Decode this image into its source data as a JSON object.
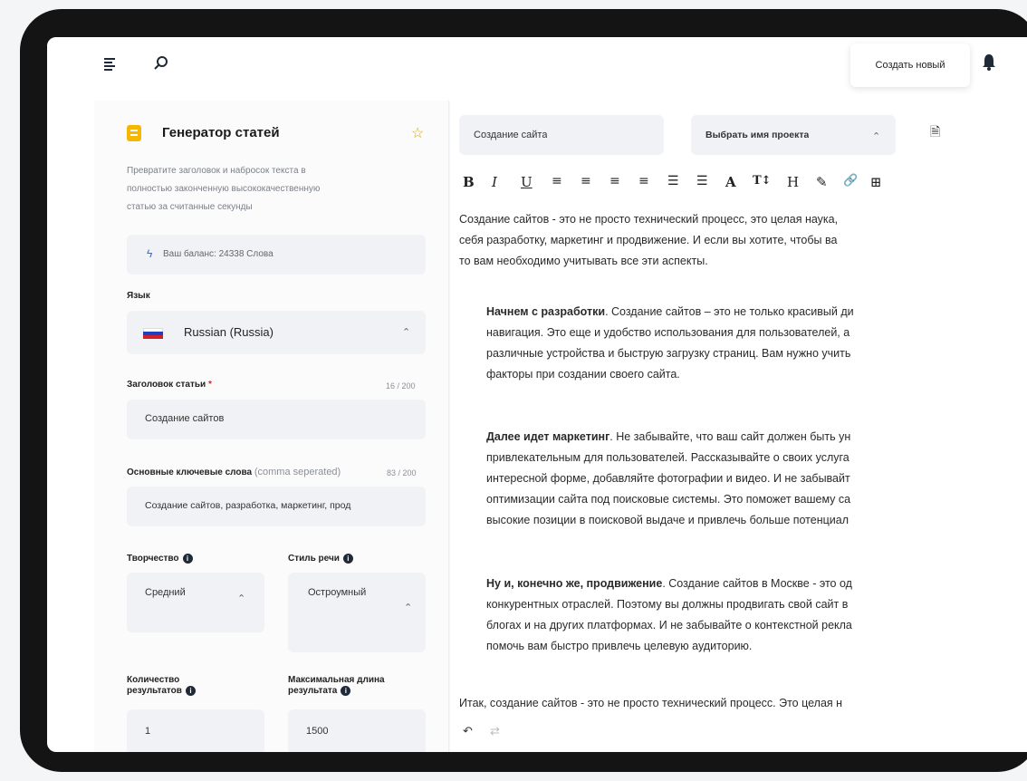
{
  "topbar": {
    "create_label": "Создать новый"
  },
  "left": {
    "title": "Генератор статей",
    "description_lines": [
      "Превратите заголовок и набросок текста в",
      "полностью законченную высококачественную",
      "статью за считанные секунды"
    ],
    "balance": "Ваш баланс: 24338 Слова",
    "language_label": "Язык",
    "language_value": "Russian (Russia)",
    "article_title_label": "Заголовок статьи",
    "required_mark": "*",
    "article_title_count": "16 / 200",
    "article_title_value": "Создание сайтов",
    "keywords_label": "Основные ключевые слова",
    "keywords_hint": "(comma seperated)",
    "keywords_count": "83 / 200",
    "keywords_value": "Создание сайтов, разработка, маркетинг, прод",
    "creativity_label": "Творчество",
    "creativity_value": "Средний",
    "tone_label": "Стиль речи",
    "tone_value": "Остроумный",
    "results_count_label_1": "Количество",
    "results_count_label_2": "результатов",
    "results_count_value": "1",
    "max_length_label_1": "Максимальная длина",
    "max_length_label_2": "результата",
    "max_length_value": "1500"
  },
  "editor": {
    "doc_name": "Создание сайта",
    "project_select": "Выбрать имя проекта",
    "toolbar": [
      "B",
      "I",
      "U",
      "≡",
      "≡",
      "≡",
      "≡",
      "☰",
      "☰",
      "A",
      "T↕",
      "H",
      "✎",
      "🔗",
      "⊞"
    ],
    "p1": [
      "Создание сайтов - это не просто технический процесс, это целая наука,",
      "себя разработку, маркетинг и продвижение. И если вы хотите, чтобы ва",
      "то вам необходимо учитывать все эти аспекты."
    ],
    "p2_bold": "Начнем с разработки",
    "p2": [
      ". Создание сайтов – это не только красивый ди",
      "навигация. Это еще и удобство использования для пользователей, а",
      "различные устройства и быструю загрузку страниц. Вам нужно учить",
      "факторы при создании своего сайта."
    ],
    "p3_bold": "Далее идет маркетинг",
    "p3": [
      ". Не забывайте, что ваш сайт должен быть ун",
      "привлекательным для пользователей. Рассказывайте о своих услуга",
      "интересной форме, добавляйте фотографии и видео. И не забывайт",
      "оптимизации сайта под поисковые системы. Это поможет вашему са",
      "высокие позиции в поисковой выдаче и привлечь больше потенциал"
    ],
    "p4_bold": "Ну и, конечно же, продвижение",
    "p4": [
      ". Создание сайтов в Москве - это од",
      "конкурентных отраслей. Поэтому вы должны продвигать свой сайт в",
      "блогах и на других платформах. И не забывайте о контекстной рекла",
      "помочь вам быстро привлечь целевую аудиторию."
    ],
    "p5": "Итак, создание сайтов - это не просто технический процесс. Это целая н"
  }
}
